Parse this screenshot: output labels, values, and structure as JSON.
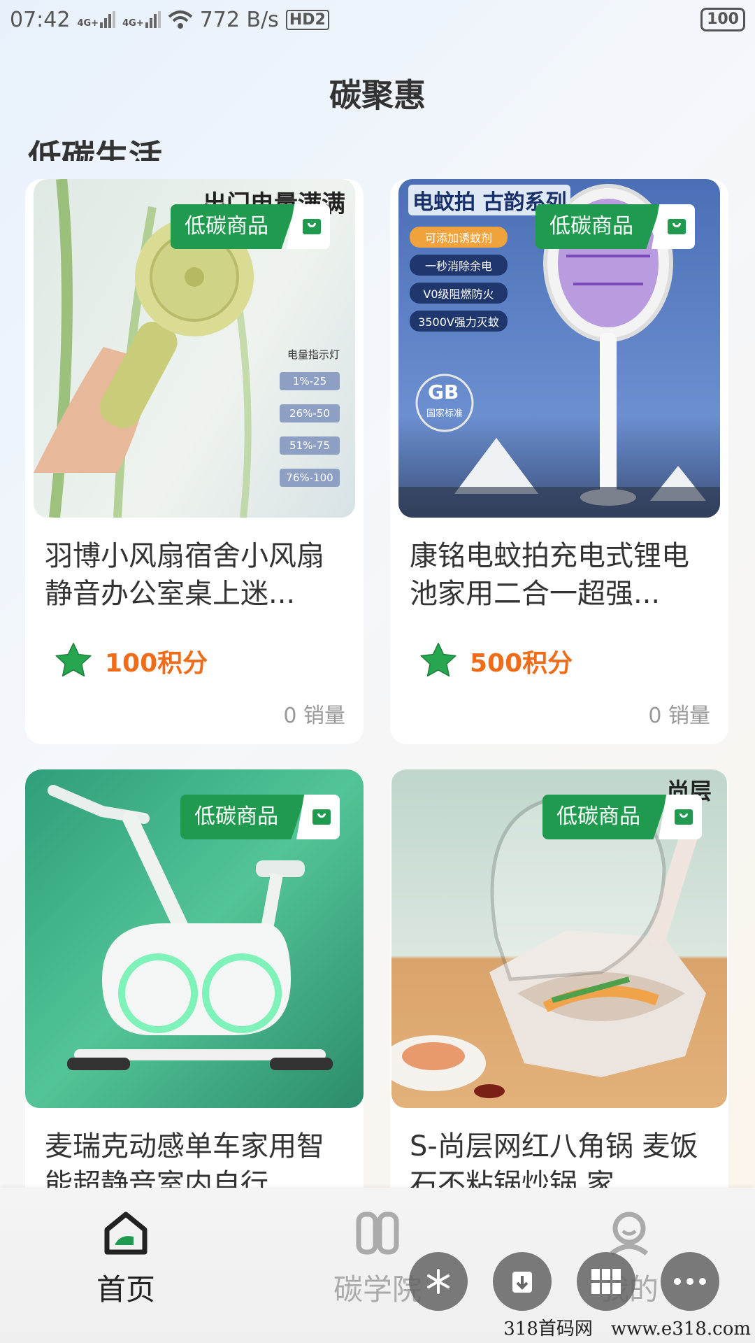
{
  "status": {
    "time": "07:42",
    "net1": "4G+",
    "net2": "4G+",
    "speed": "772 B/s",
    "hd": "HD2",
    "battery": "100"
  },
  "page": {
    "title": "碳聚惠",
    "section": "低碳生活"
  },
  "products": [
    {
      "name": "羽博小风扇宿舍小风扇静音办公室桌上迷...",
      "tag": "低碳商品",
      "points": "100积分",
      "sales": "0 销量"
    },
    {
      "name": "康铭电蚊拍充电式锂电池家用二合一超强...",
      "tag": "低碳商品",
      "points": "500积分",
      "sales": "0 销量"
    },
    {
      "name": "麦瑞克动感单车家用智能超静音室内自行...",
      "tag": "低碳商品",
      "points": "",
      "sales": ""
    },
    {
      "name": "S-尚层网红八角锅 麦饭石不粘锅炒锅 家...",
      "tag": "低碳商品",
      "points": "",
      "sales": ""
    }
  ],
  "image_text": {
    "p1_top": "出门电量满满",
    "p1_indicator": "电量指示灯",
    "p1_levels": [
      "1%-25",
      "26%-50",
      "51%-75",
      "76%-100"
    ],
    "p2_top": "电蚊拍 古韵系列",
    "p2_features": [
      "可添加诱蚊剂",
      "一秒消除余电",
      "V0级阻燃防火",
      "3500V强力灭蚊"
    ],
    "p2_gb": "GB",
    "p2_gb_sub": "国家标准",
    "p4_top": "尚层"
  },
  "nav": {
    "home": "首页",
    "academy": "碳学院",
    "mine": "我的"
  },
  "watermark": "318首码网　www.e318.com",
  "colors": {
    "brand_green": "#1f9a4f",
    "points_orange": "#ef6c1a"
  }
}
